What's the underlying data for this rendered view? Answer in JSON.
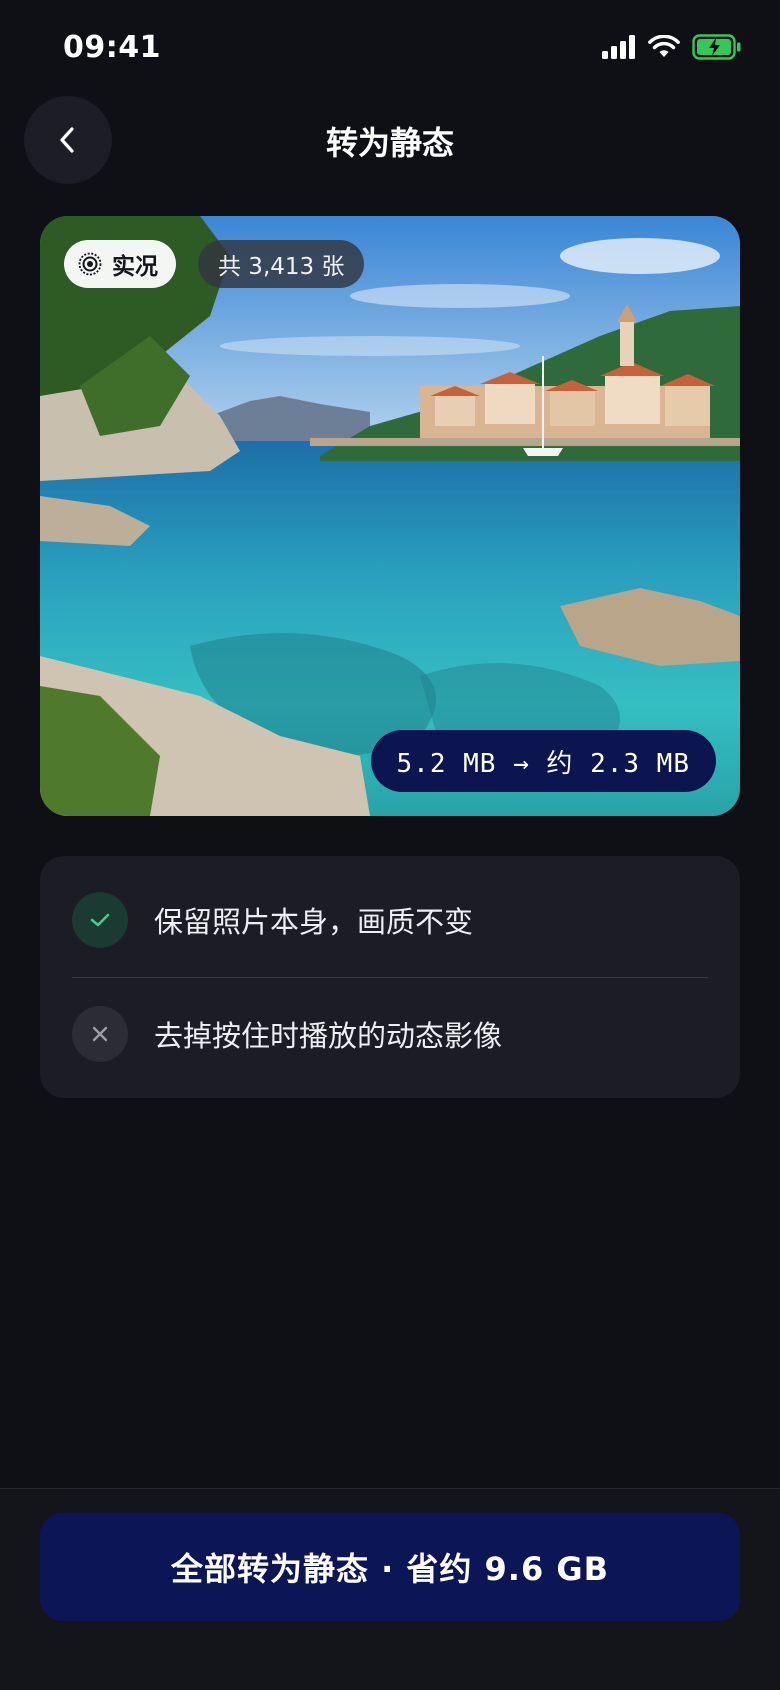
{
  "status_bar": {
    "time": "09:41",
    "icons": [
      "signal-icon",
      "wifi-icon",
      "battery-charging-icon"
    ],
    "battery_color": "#35c759"
  },
  "header": {
    "title": "转为静态",
    "back_icon": "chevron-left-icon"
  },
  "photo": {
    "live_label": "实况",
    "live_icon": "live-photo-icon",
    "count_label": "共 3,413 张",
    "size_label": "5.2 MB → 约 2.3 MB"
  },
  "info": {
    "items": [
      {
        "icon": "check-icon",
        "text": "保留照片本身，画质不变",
        "accent": "#3ecf8e"
      },
      {
        "icon": "close-icon",
        "text": "去掉按住时播放的动态影像",
        "accent": "#9a9ca6"
      }
    ]
  },
  "action": {
    "button_label": "全部转为静态 · 省约 9.6 GB",
    "button_color": "#0c1657"
  }
}
